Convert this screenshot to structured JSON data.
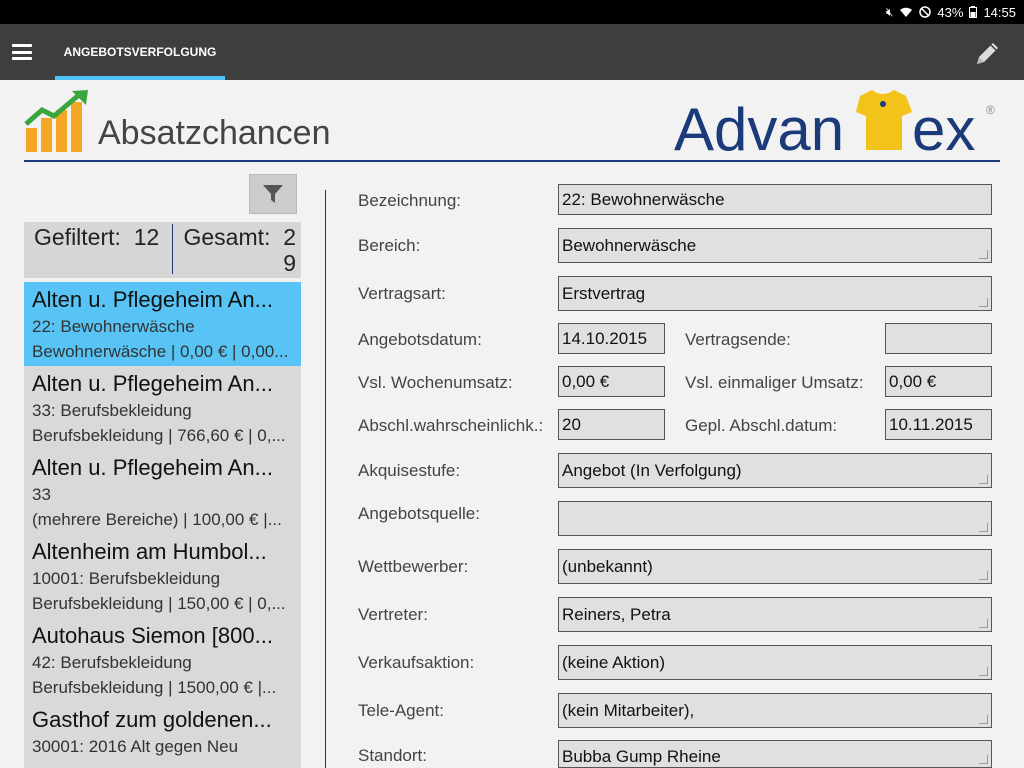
{
  "status": {
    "battery": "43%",
    "time": "14:55"
  },
  "appbar": {
    "tab_label": "ANGEBOTSVERFOLGUNG"
  },
  "header": {
    "title": "Absatzchancen",
    "brand_prefix": "Advan",
    "brand_suffix": "ex",
    "brand_reg": "®"
  },
  "counts": {
    "filtered_label": "Gefiltert:",
    "filtered": "12",
    "total_label": "Gesamt:",
    "total": "29"
  },
  "list": [
    {
      "title": "Alten u. Pflegeheim An...",
      "line1": "22: Bewohnerwäsche",
      "line2": "Bewohnerwäsche | 0,00 € | 0,00...",
      "selected": true
    },
    {
      "title": "Alten u. Pflegeheim An...",
      "line1": "33: Berufsbekleidung",
      "line2": "Berufsbekleidung | 766,60 € | 0,...",
      "selected": false
    },
    {
      "title": "Alten u. Pflegeheim An...",
      "line1": "33",
      "line2": "(mehrere Bereiche) | 100,00 € |...",
      "selected": false
    },
    {
      "title": "Altenheim am Humbol...",
      "line1": "10001: Berufsbekleidung",
      "line2": "Berufsbekleidung | 150,00 € | 0,...",
      "selected": false
    },
    {
      "title": "Autohaus Siemon [800...",
      "line1": "42: Berufsbekleidung",
      "line2": "Berufsbekleidung | 1500,00 € |...",
      "selected": false
    },
    {
      "title": "Gasthof zum goldenen...",
      "line1": "30001: 2016 Alt gegen Neu",
      "line2": "",
      "selected": false
    }
  ],
  "form": {
    "bezeichnung": {
      "label": "Bezeichnung:",
      "value": "22: Bewohnerwäsche"
    },
    "bereich": {
      "label": "Bereich:",
      "value": "Bewohnerwäsche"
    },
    "vertragsart": {
      "label": "Vertragsart:",
      "value": "Erstvertrag"
    },
    "angebotsdatum": {
      "label": "Angebotsdatum:",
      "value": "14.10.2015"
    },
    "vertragsende": {
      "label": "Vertragsende:",
      "value": ""
    },
    "wochenumsatz": {
      "label": "Vsl. Wochenumsatz:",
      "value": "0,00 €"
    },
    "einmaliger": {
      "label": "Vsl. einmaliger Umsatz:",
      "value": "0,00 €"
    },
    "wahrscheinlichkeit": {
      "label": "Abschl.wahrscheinlichk.:",
      "value": "20"
    },
    "abschlussdatum": {
      "label": "Gepl. Abschl.datum:",
      "value": "10.11.2015"
    },
    "akquisestufe": {
      "label": "Akquisestufe:",
      "value": "Angebot (In Verfolgung)"
    },
    "angebotsquelle": {
      "label": "Angebotsquelle:",
      "value": ""
    },
    "wettbewerber": {
      "label": "Wettbewerber:",
      "value": "(unbekannt)"
    },
    "vertreter": {
      "label": "Vertreter:",
      "value": "Reiners, Petra"
    },
    "verkaufsaktion": {
      "label": "Verkaufsaktion:",
      "value": "(keine Aktion)"
    },
    "teleagent": {
      "label": "Tele-Agent:",
      "value": "(kein Mitarbeiter),"
    },
    "standort": {
      "label": "Standort:",
      "value": "Bubba Gump Rheine"
    }
  }
}
